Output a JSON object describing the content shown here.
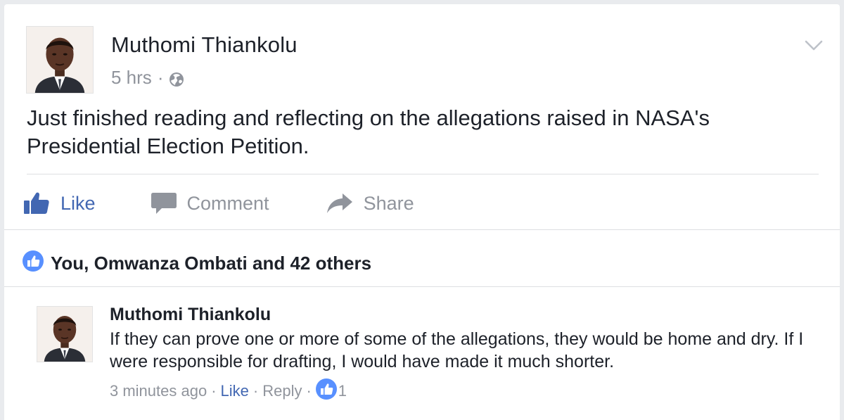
{
  "post": {
    "author": "Muthomi Thiankolu",
    "time": "5 hrs",
    "dot": "·",
    "privacy_icon": "globe-icon",
    "menu_icon": "chevron-down-icon",
    "text": "Just finished reading and reflecting on the allegations raised in NASA's Presidential Election Petition."
  },
  "actions": {
    "like_label": "Like",
    "comment_label": "Comment",
    "share_label": "Share"
  },
  "reactions": {
    "summary": "You, Omwanza Ombati and 42 others"
  },
  "comment": {
    "author": "Muthomi Thiankolu",
    "text": "If they can prove one or more of some of the allegations, they would be home and dry. If I were responsible for drafting, I would have made it much shorter.",
    "time": "3 minutes ago",
    "like_label": "Like",
    "reply_label": "Reply",
    "sep": "·",
    "like_count": "1"
  },
  "colors": {
    "accent": "#4267b2",
    "like_bubble": "#5890ff",
    "muted": "#90949c",
    "text": "#1d2129",
    "divider": "#dddfe2"
  }
}
